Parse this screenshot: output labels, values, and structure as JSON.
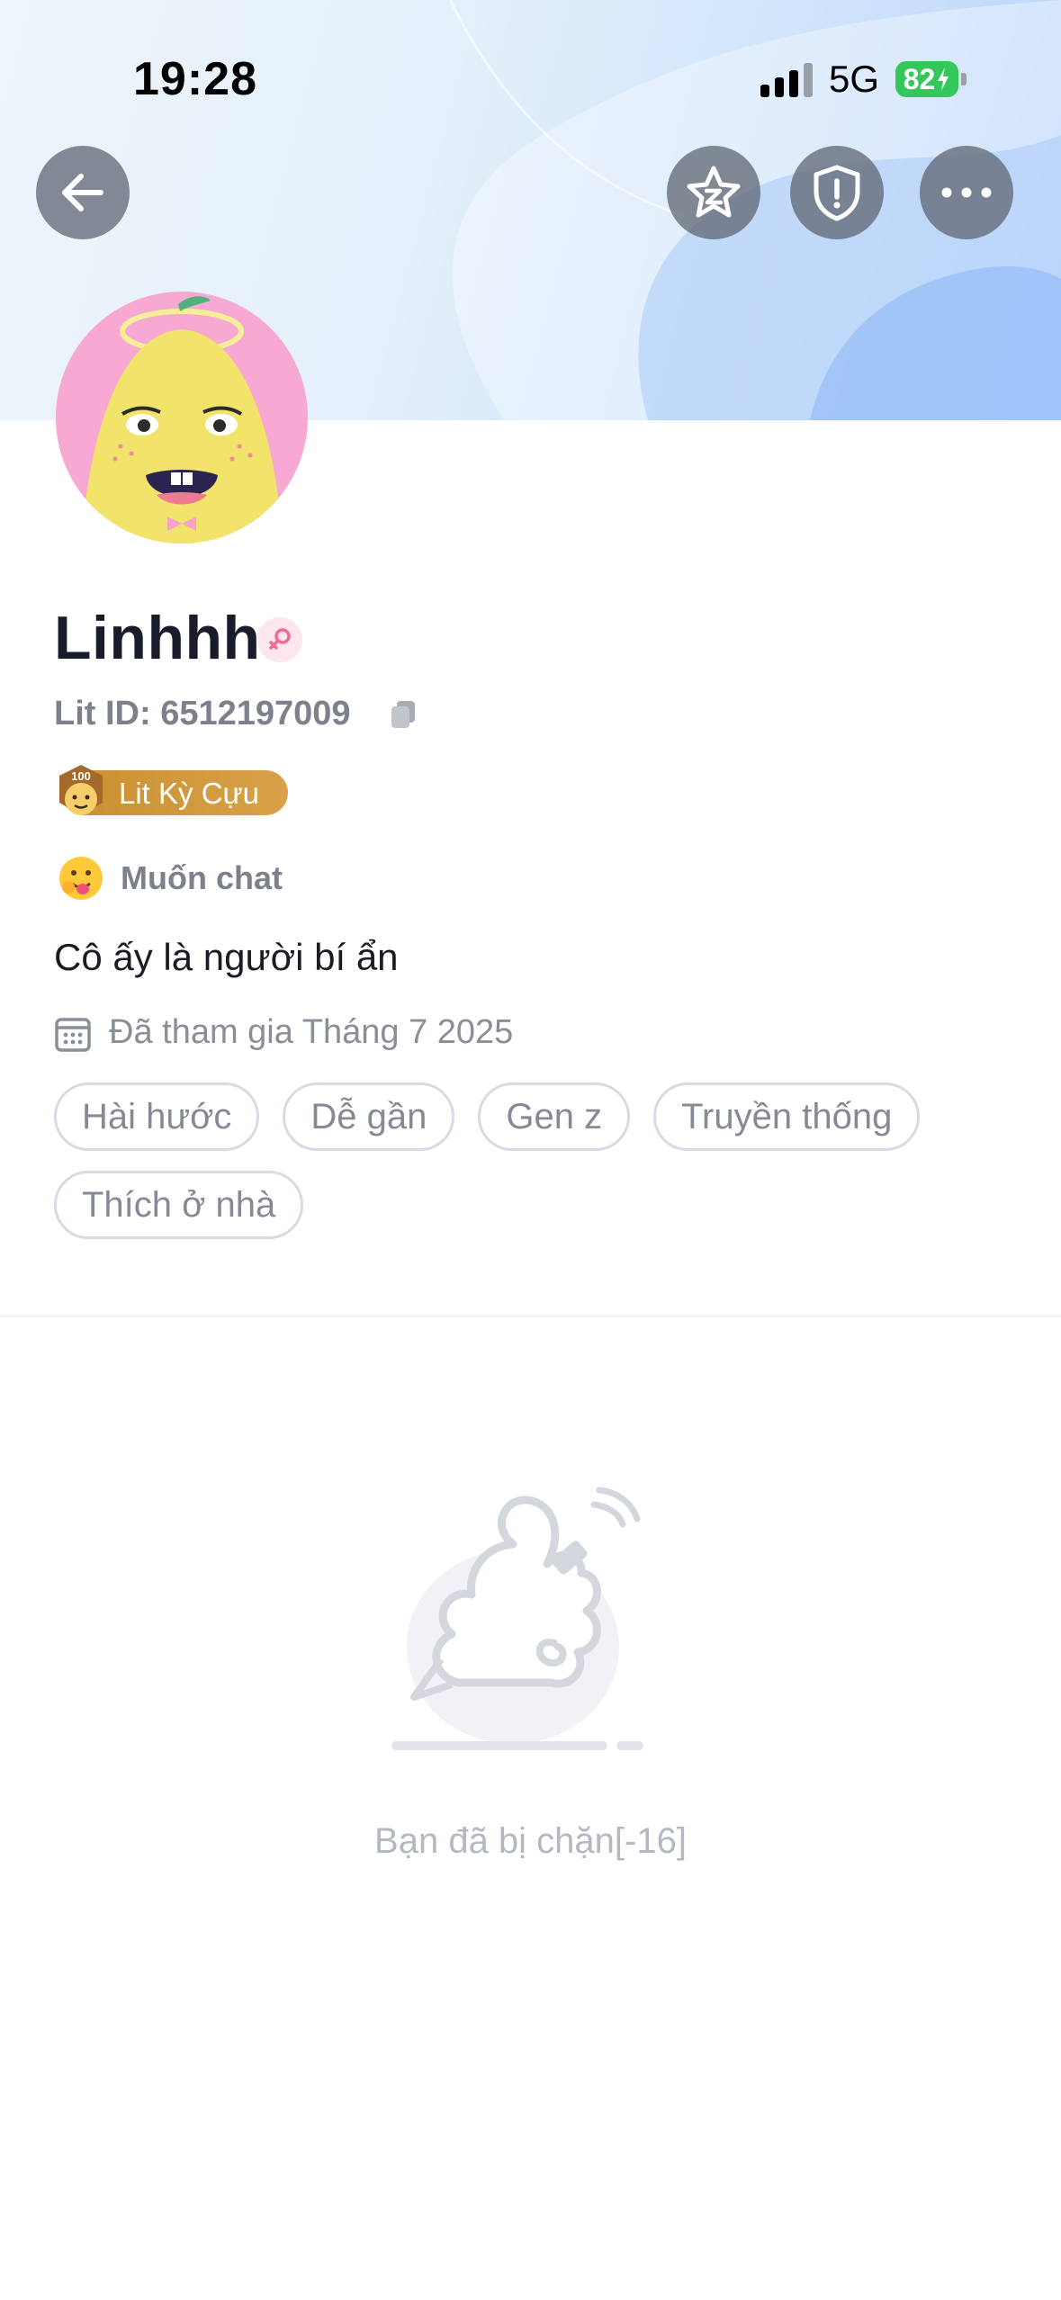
{
  "status_bar": {
    "time": "19:28",
    "network": "5G",
    "battery": "82"
  },
  "header": {
    "back_icon": "arrow-left-icon",
    "actions": [
      "star-badge-icon",
      "shield-alert-icon",
      "more-icon"
    ]
  },
  "profile": {
    "name": "Linhhh",
    "gender_icon": "female-symbol-icon",
    "lit_id": "Lit ID: 6512197009",
    "rank_badge": "Lit Kỳ Cựu",
    "rank_badge_number": "100",
    "mood": "Muốn chat",
    "bio": "Cô ấy là người bí ẩn",
    "joined": "Đã tham gia Tháng 7 2025",
    "tags": [
      "Hài hước",
      "Dễ gần",
      "Gen z",
      "Truyền thống",
      "Thích ở nhà"
    ]
  },
  "content": {
    "empty_message": "Bạn đã bị chặn[-16]"
  },
  "colors": {
    "accent_gold": "#d29a3d",
    "avatar_bg": "#f7a8d3",
    "avatar_face": "#f2e46a",
    "battery_green": "#34c759"
  }
}
